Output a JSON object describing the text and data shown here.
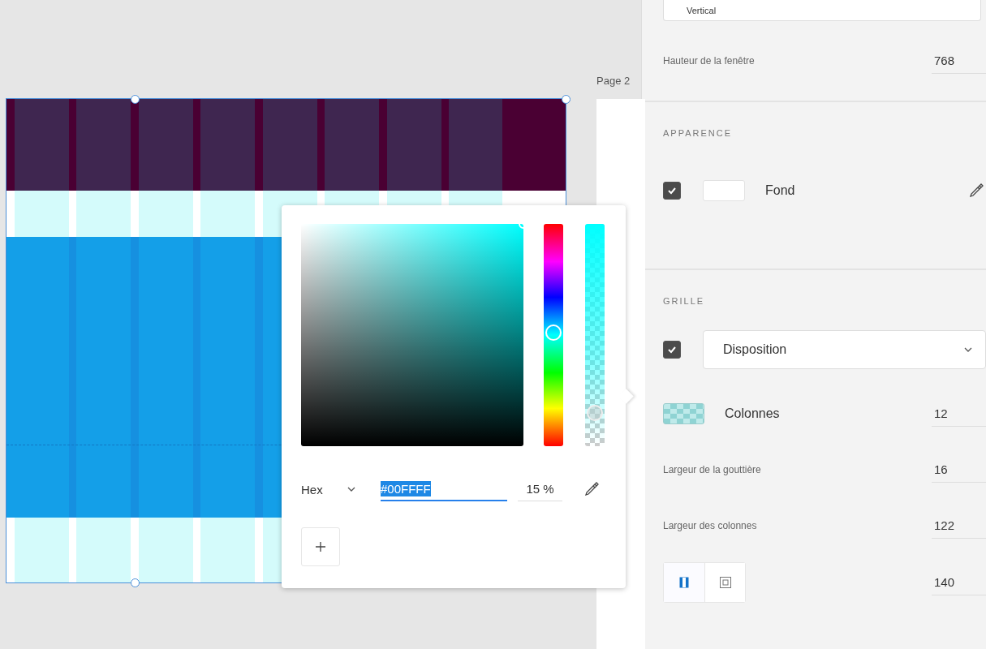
{
  "canvas": {
    "artboard_label": "Page 2"
  },
  "color_picker": {
    "hue": {
      "level": 0.49
    },
    "alpha": {
      "level": 0.15
    },
    "format": "Hex",
    "hex": "#00FFFF",
    "opacity": "15 %"
  },
  "properties": {
    "orientation_dropdown": {
      "value": "Vertical"
    },
    "window_height": {
      "label": "Hauteur de la fenêtre",
      "value": "768"
    },
    "appearance": {
      "title": "APPARENCE",
      "fill": {
        "checked": true,
        "label": "Fond"
      }
    },
    "grid": {
      "title": "GRILLE",
      "enabled": true,
      "type": "Disposition",
      "columns": {
        "label": "Colonnes",
        "value": "12"
      },
      "fields": [
        {
          "label": "Largeur de la gouttière",
          "value": "16"
        },
        {
          "label": "Largeur des colonnes",
          "value": "122"
        }
      ],
      "modes": [
        {
          "kind": "columns",
          "selected": true
        },
        {
          "kind": "margins",
          "selected": false
        }
      ],
      "mode_value": "140"
    }
  }
}
